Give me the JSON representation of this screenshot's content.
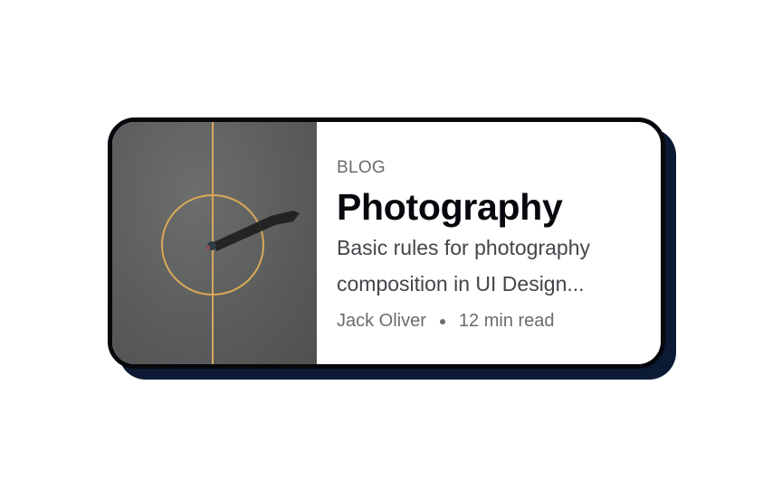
{
  "card": {
    "category": "BLOG",
    "title": "Photography",
    "description_line1": "Basic rules for photography",
    "description_line2": "composition in UI Design...",
    "author": "Jack Oliver",
    "read_time": "12 min read"
  },
  "colors": {
    "border": "#07080d",
    "shadow": "#0c1a33",
    "court_line": "#d9a85a"
  }
}
